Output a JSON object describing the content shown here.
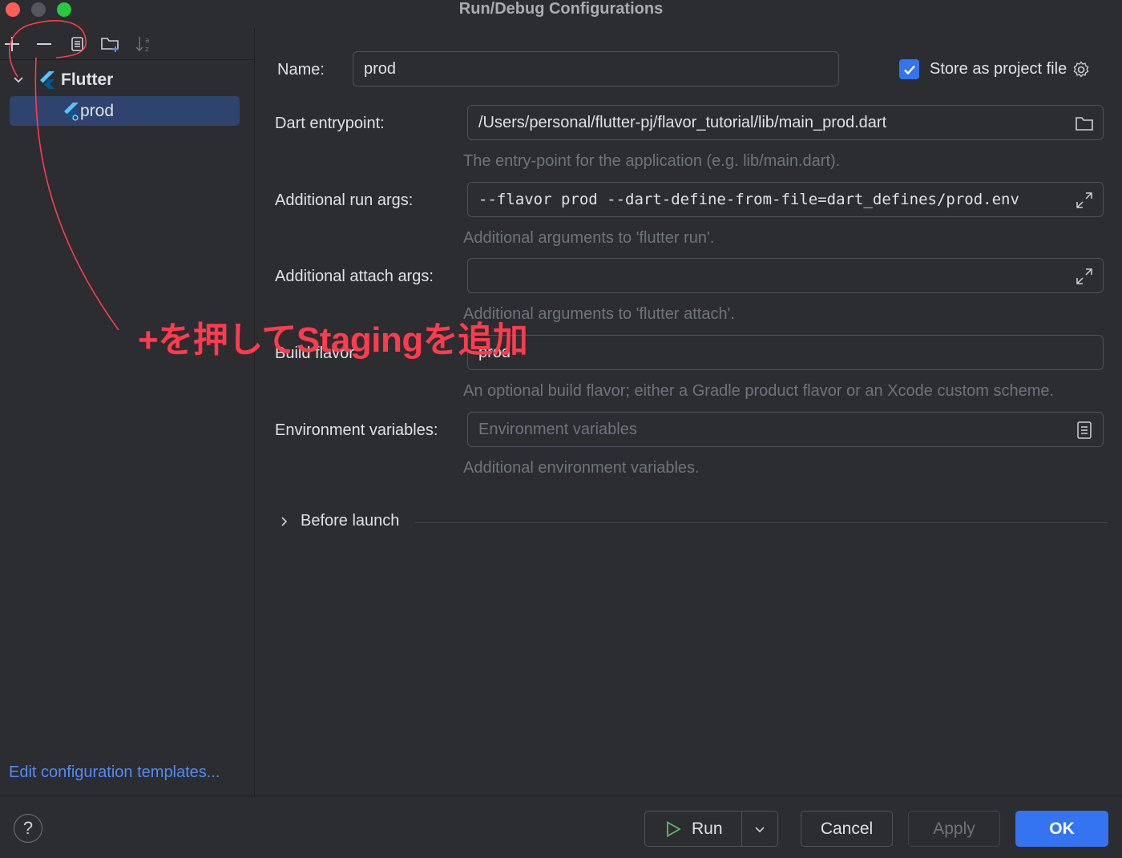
{
  "window": {
    "title": "Run/Debug Configurations"
  },
  "toolbar": {
    "icons": [
      "plus-icon",
      "minus-icon",
      "copy-icon",
      "folder-add-icon",
      "sort-alpha-icon"
    ]
  },
  "tree": {
    "group_label": "Flutter",
    "items": [
      {
        "label": "prod",
        "selected": true
      }
    ]
  },
  "edit_templates_link": "Edit configuration templates...",
  "form": {
    "name_label": "Name:",
    "name_value": "prod",
    "store_label": "Store as project file",
    "store_checked": true,
    "entry_label": "Dart entrypoint:",
    "entry_value": "/Users/personal/flutter-pj/flavor_tutorial/lib/main_prod.dart",
    "entry_hint": "The entry-point for the application (e.g. lib/main.dart).",
    "run_args_label": "Additional run args:",
    "run_args_value": "--flavor prod --dart-define-from-file=dart_defines/prod.env",
    "run_args_hint": "Additional arguments to 'flutter run'.",
    "attach_args_label": "Additional attach args:",
    "attach_args_value": "",
    "attach_args_hint": "Additional arguments to 'flutter attach'.",
    "flavor_label": "Build flavor:",
    "flavor_value": "prod",
    "flavor_hint": "An optional build flavor; either a Gradle product flavor or an Xcode custom scheme.",
    "env_label": "Environment variables:",
    "env_placeholder": "Environment variables",
    "env_hint": "Additional environment variables.",
    "before_launch_label": "Before launch"
  },
  "buttons": {
    "help": "?",
    "run": "Run",
    "cancel": "Cancel",
    "apply": "Apply",
    "ok": "OK"
  },
  "annotation": {
    "text": "+を押してStagingを追加",
    "color": "#ff3b4e"
  },
  "colors": {
    "accent": "#3574f0",
    "link": "#548af7",
    "selection": "#2e436e",
    "background": "#2b2d30"
  }
}
